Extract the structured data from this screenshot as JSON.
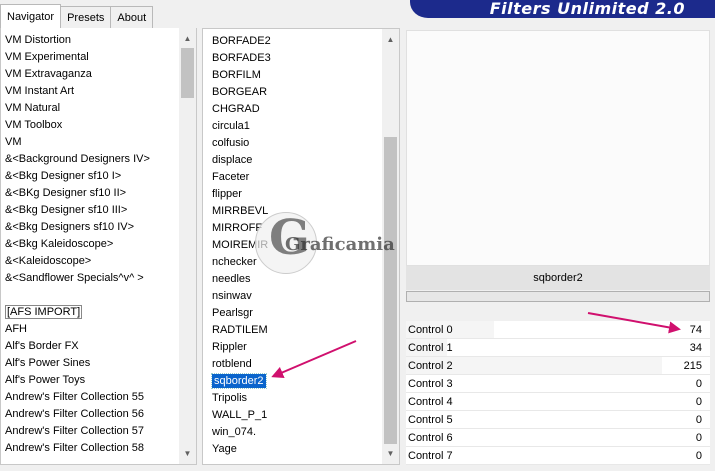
{
  "tabs": [
    "Navigator",
    "Presets",
    "About"
  ],
  "app_title": "Filters Unlimited 2.0",
  "categories": [
    "VM Distortion",
    "VM Experimental",
    "VM Extravaganza",
    "VM Instant Art",
    "VM Natural",
    "VM Toolbox",
    "VM",
    "&<Background Designers IV>",
    "&<Bkg Designer sf10 I>",
    "&<BKg Designer sf10 II>",
    "&<Bkg Designer sf10 III>",
    "&<Bkg Designers sf10 IV>",
    "&<Bkg Kaleidoscope>",
    "&<Kaleidoscope>",
    "&<Sandflower Specials^v^ >",
    "",
    "[AFS IMPORT]",
    "AFH",
    "Alf's Border FX",
    "Alf's Power Sines",
    "Alf's Power Toys",
    "Andrew's Filter Collection 55",
    "Andrew's Filter Collection 56",
    "Andrew's Filter Collection 57",
    "Andrew's Filter Collection 58"
  ],
  "filters": [
    "BORFADE2",
    "BORFADE3",
    "BORFILM",
    "BORGEAR",
    "CHGRAD",
    "circula1",
    "colfusio",
    "displace",
    "Faceter",
    "flipper",
    "MIRRBEVL",
    "MIRROFF",
    "MOIREMIR",
    "nchecker",
    "needles",
    "nsinwav",
    "Pearlsgr",
    "RADTILEM",
    "Rippler",
    "rotblend",
    "sqborder2",
    "Tripolis",
    "WALL_P_1",
    "win_074.",
    "Yage"
  ],
  "selected_filter": "sqborder2",
  "filter_name": "sqborder2",
  "controls": [
    {
      "label": "Control 0",
      "value": "74",
      "level": 74
    },
    {
      "label": "Control 1",
      "value": "34",
      "level": 34
    },
    {
      "label": "Control 2",
      "value": "215",
      "level": 215
    },
    {
      "label": "Control 3",
      "value": "0",
      "level": 0
    },
    {
      "label": "Control 4",
      "value": "0",
      "level": 0
    },
    {
      "label": "Control 5",
      "value": "0",
      "level": 0
    },
    {
      "label": "Control 6",
      "value": "0",
      "level": 0
    },
    {
      "label": "Control 7",
      "value": "0",
      "level": 0
    }
  ],
  "watermark_text": "Graficamia",
  "colors": {
    "banner": "#1c2a8c",
    "selection": "#0a64cc",
    "arrow": "#d0106e"
  },
  "icons": {
    "scroll_up": "triangle-up-icon",
    "scroll_down": "triangle-down-icon"
  }
}
